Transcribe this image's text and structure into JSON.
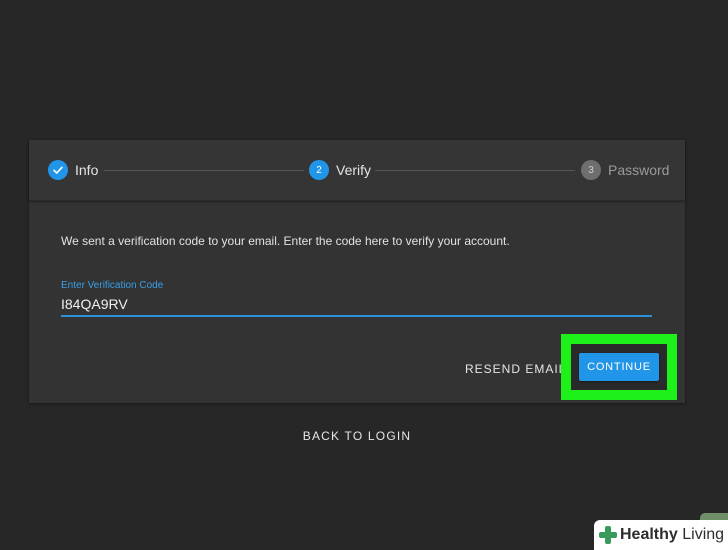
{
  "stepper": {
    "steps": [
      {
        "label": "Info",
        "state": "completed"
      },
      {
        "label": "Verify",
        "number": "2",
        "state": "active"
      },
      {
        "label": "Password",
        "number": "3",
        "state": "inactive"
      }
    ]
  },
  "form": {
    "instruction": "We sent a verification code to your email. Enter the code here to verify your account.",
    "code_field": {
      "label": "Enter Verification Code",
      "value": "I84QA9RV"
    },
    "resend_label": "RESEND EMAIL",
    "continue_label": "CONTINUE"
  },
  "back_to_login_label": "BACK TO LOGIN",
  "watermark": {
    "brand_bold": "Healthy",
    "brand_regular": " Living"
  },
  "colors": {
    "background": "#272727",
    "card": "#333333",
    "accent": "#2196e8",
    "highlight": "#1ef01a"
  }
}
